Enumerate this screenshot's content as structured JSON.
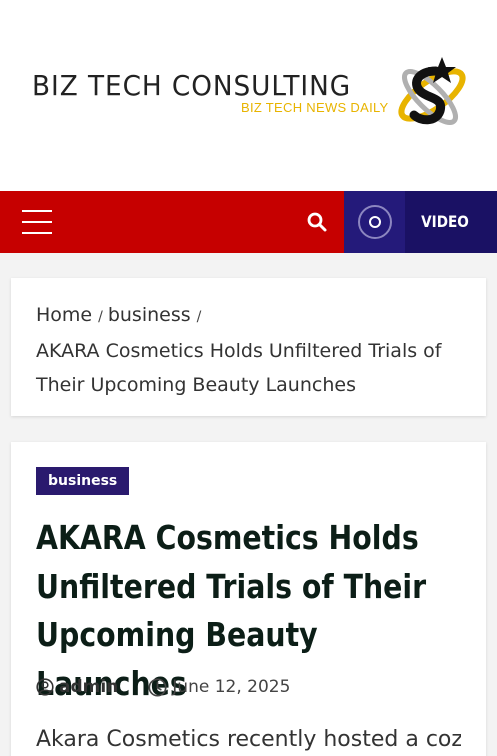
{
  "site": {
    "title": "BIZ TECH CONSULTING",
    "tagline": "BIZ TECH NEWS DAILY",
    "brand_colors": {
      "gold": "#e8b400",
      "dark": "#222222",
      "nav_red": "#c60000",
      "navy": "#1a1164"
    }
  },
  "navbar": {
    "menu_icon": "hamburger-icon",
    "search_icon": "search-icon",
    "video_icon": "play-circle-icon",
    "video_label": "VIDEO"
  },
  "breadcrumb": {
    "items": [
      {
        "label": "Home"
      },
      {
        "label": "business"
      }
    ],
    "separator": "/",
    "current": "AKARA Cosmetics Holds Unfiltered Trials of Their Upcoming Beauty Launches"
  },
  "article": {
    "category": "business",
    "title": "AKARA Cosmetics Holds Unfiltered Trials of Their Upcoming Beauty Launches",
    "author": "admin",
    "date": "June 12, 2025",
    "excerpt": "Akara Cosmetics recently hosted a cozy",
    "author_icon": "user-circle-icon",
    "date_icon": "clock-icon"
  }
}
